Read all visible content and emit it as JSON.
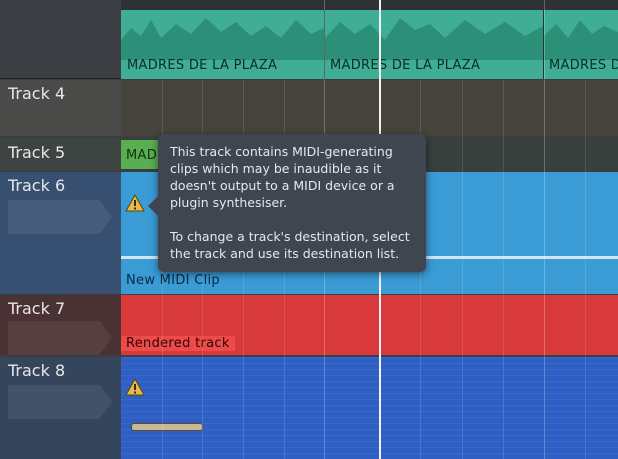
{
  "tracks": [
    {
      "id": "t3",
      "name": "",
      "clips": [
        "MADRES DE LA PLAZA",
        "MADRES DE LA PLAZA",
        "MADRES DE"
      ]
    },
    {
      "id": "t4",
      "name": "Track 4"
    },
    {
      "id": "t5",
      "name": "Track 5",
      "clip": "MAD"
    },
    {
      "id": "t6",
      "name": "Track 6",
      "clip": "New MIDI Clip"
    },
    {
      "id": "t7",
      "name": "Track 7",
      "clip": "Rendered track"
    },
    {
      "id": "t8",
      "name": "Track 8"
    }
  ],
  "tooltip": {
    "para1": "This track contains MIDI-generating clips which may be inaudible as it doesn't output to a MIDI device or a plugin synthesiser.",
    "para2": "To change a track's destination, select the track and use its destination list."
  },
  "colors": {
    "audio_clip": "#3fae94",
    "midi_clip": "#3a9bd5",
    "rendered": "#d8393b",
    "track8": "#2f5fc4",
    "header": "#4a4c4f"
  },
  "icons": {
    "warning": "warning-icon"
  }
}
